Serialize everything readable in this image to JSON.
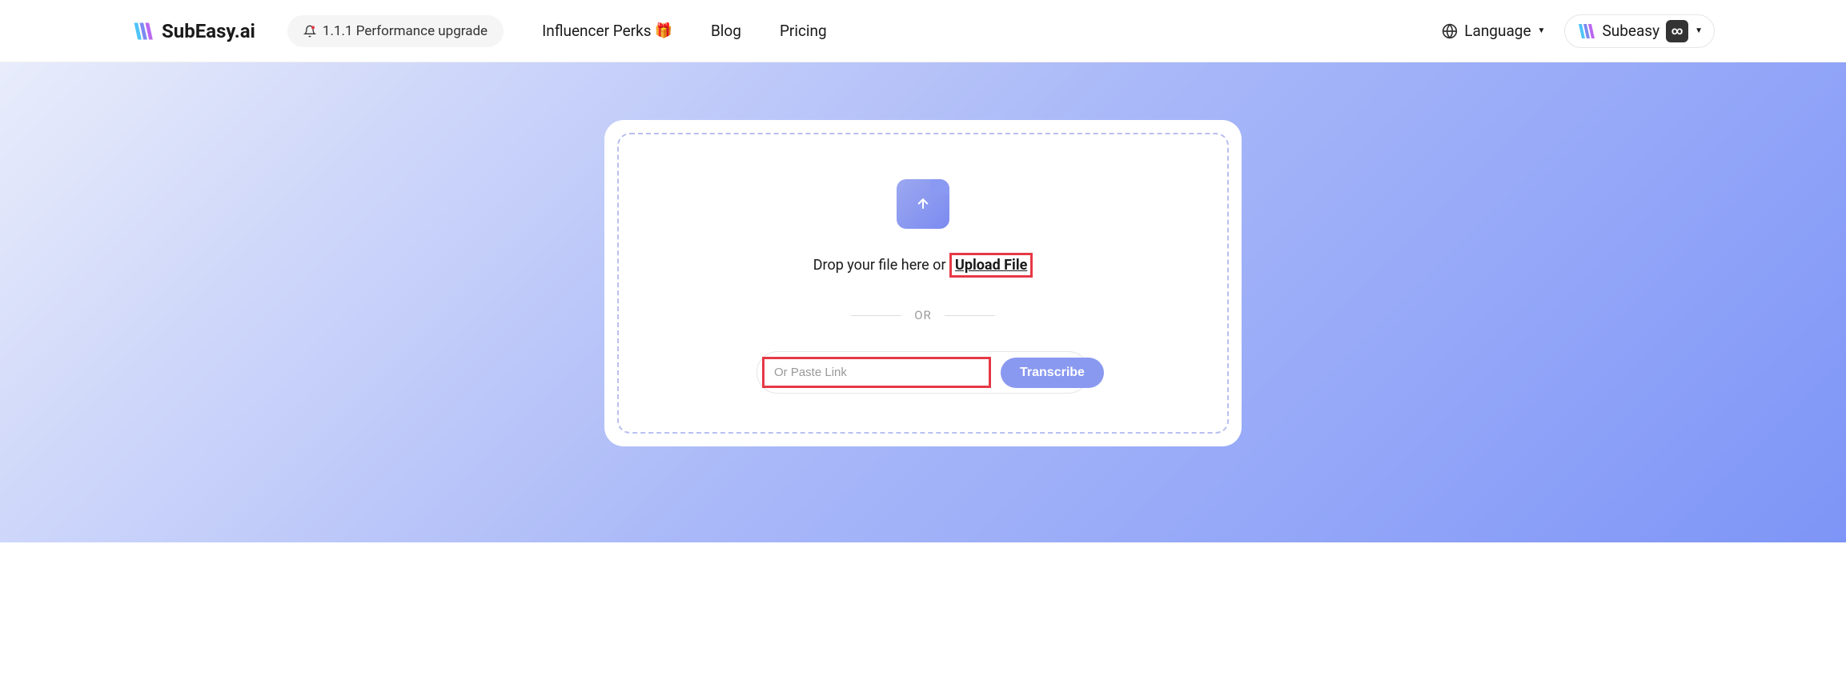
{
  "header": {
    "brand": "SubEasy.ai",
    "promo": "1.1.1 Performance upgrade",
    "nav": {
      "influencer": "Influencer Perks",
      "blog": "Blog",
      "pricing": "Pricing",
      "language": "Language"
    },
    "user": {
      "name": "Subeasy"
    }
  },
  "upload": {
    "drop_text": "Drop your file here or ",
    "upload_link": "Upload File",
    "or_label": "OR",
    "input_placeholder": "Or Paste Link",
    "transcribe_button": "Transcribe"
  }
}
